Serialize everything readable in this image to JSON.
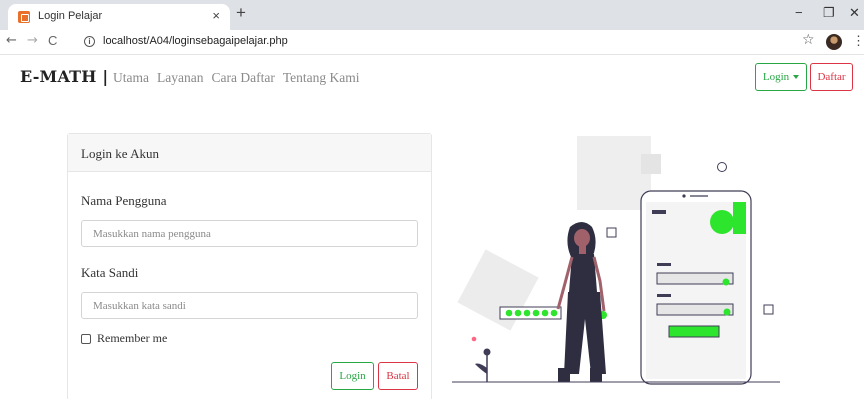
{
  "browser": {
    "tab_title": "Login Pelajar",
    "tab_close": "×",
    "new_tab": "+",
    "url": "localhost/A04/loginsebagaipelajar.php",
    "back": "←",
    "forward": "→",
    "reload": "C",
    "info": "i",
    "star": "☆",
    "menu": "⋮",
    "minimize": "−",
    "restore": "❐",
    "close": "✕",
    "favicon_icon": "app-favicon-icon",
    "profile_icon": "profile-avatar-icon"
  },
  "site": {
    "brand": "E-MATH |",
    "nav": [
      "Utama",
      "Layanan",
      "Cara Daftar",
      "Tentang Kami"
    ],
    "login_button": "Login",
    "daftar_button": "Daftar"
  },
  "form": {
    "header": "Login ke Akun",
    "username_label": "Nama Pengguna",
    "username_placeholder": "Masukkan nama pengguna",
    "username_value": "",
    "password_label": "Kata Sandi",
    "password_placeholder": "Masukkan kata sandi",
    "password_value": "",
    "remember_label": "Remember me",
    "remember_checked": false,
    "login_button": "Login",
    "cancel_button": "Batal"
  },
  "colors": {
    "success": "#28a745",
    "danger": "#dc3545",
    "accent_green": "#2ee52e",
    "dark_ink": "#3f3d56",
    "figure_dark": "#2f2e41"
  }
}
